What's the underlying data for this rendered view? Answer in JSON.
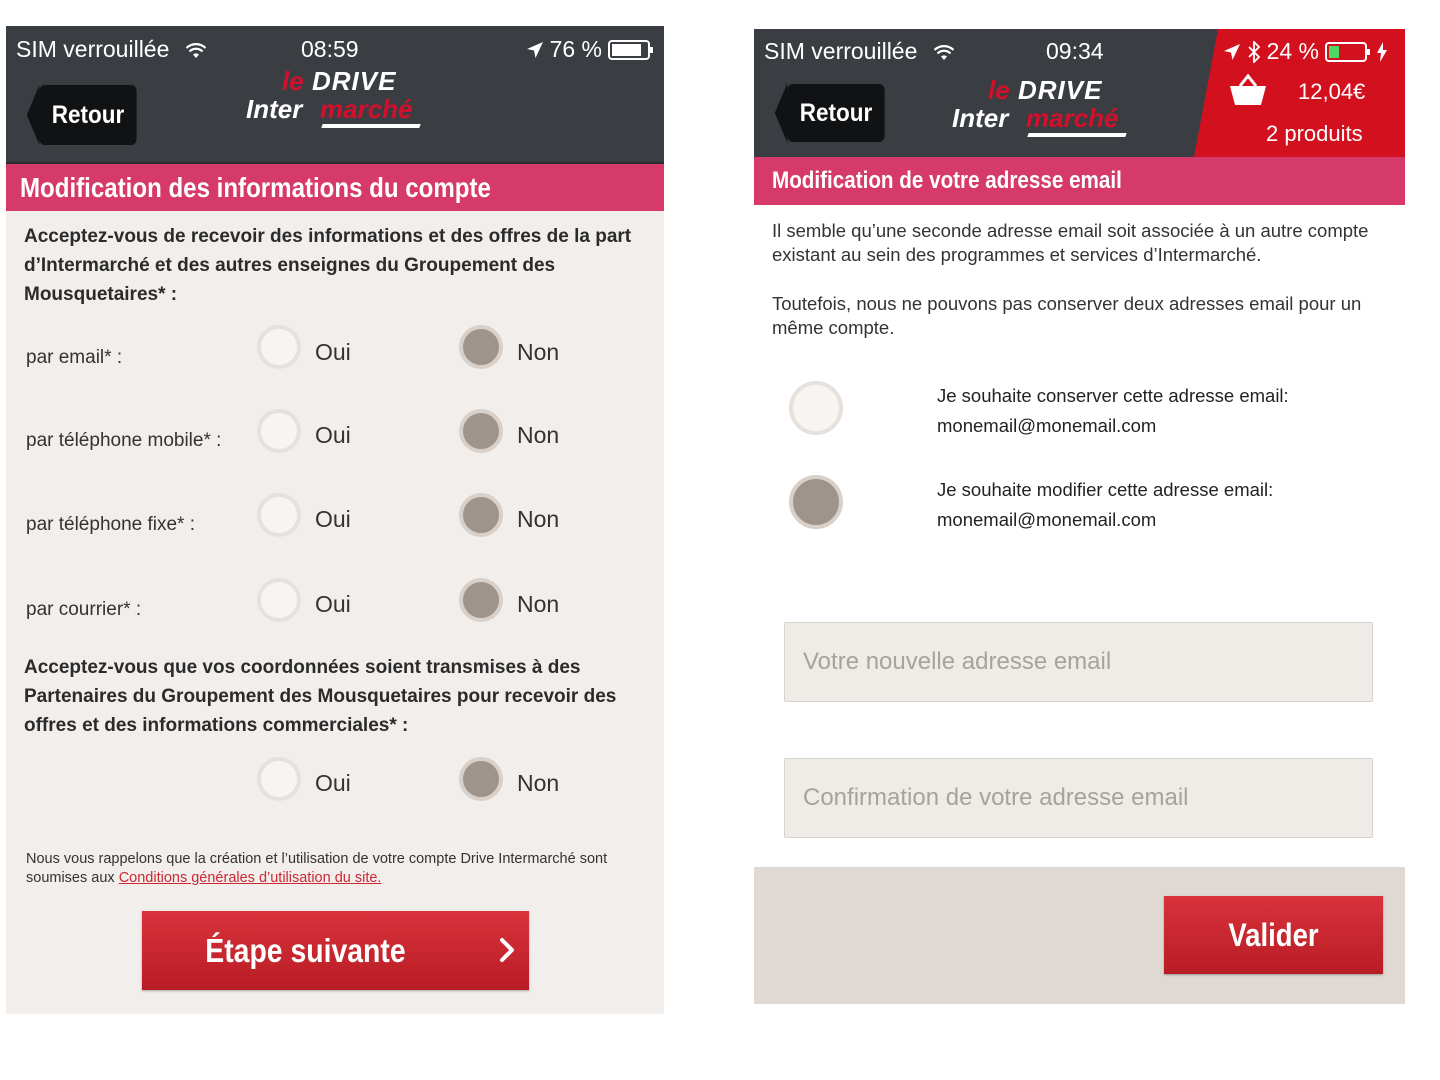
{
  "left_screen": {
    "status": {
      "carrier": "SIM verrouillée",
      "time": "08:59",
      "battery": "76 %"
    },
    "header": {
      "back_label": "Retour",
      "logo_le": "le",
      "logo_drive": "DRIVE",
      "logo_inter": "Inter",
      "logo_marche": "marché"
    },
    "title": "Modification des informations du compte",
    "question1": "Acceptez-vous de recevoir des informations et des offres de la part d’Intermarché et des autres enseignes du Groupement des Mousquetaires* :",
    "rows": [
      {
        "label": "par email* :",
        "yes": "Oui",
        "no": "Non",
        "selected": "no"
      },
      {
        "label": "par téléphone mobile* :",
        "yes": "Oui",
        "no": "Non",
        "selected": "no"
      },
      {
        "label": "par téléphone fixe* :",
        "yes": "Oui",
        "no": "Non",
        "selected": "no"
      },
      {
        "label": "par courrier* :",
        "yes": "Oui",
        "no": "Non",
        "selected": "no"
      }
    ],
    "question2": "Acceptez-vous que vos coordonnées soient transmises à des Partenaires du Groupement des Mousquetaires pour recevoir des offres et des informations commerciales* :",
    "q2_answer": {
      "yes": "Oui",
      "no": "Non",
      "selected": "no"
    },
    "fineprint_text": "Nous vous rappelons que la création et l’utilisation de votre compte Drive Intermarché sont soumises aux ",
    "fineprint_link": "Conditions générales d’utilisation du site.",
    "next_button": "Étape suivante",
    "next_arrow": "›"
  },
  "right_screen": {
    "status": {
      "carrier": "SIM verrouillée",
      "time": "09:34",
      "battery": "24 %"
    },
    "header": {
      "back_label": "Retour",
      "logo_le": "le",
      "logo_drive": "DRIVE",
      "logo_inter": "Inter",
      "logo_marche": "marché"
    },
    "cart": {
      "total": "12,04€",
      "count": "2 produits"
    },
    "title": "Modification de votre adresse email",
    "paragraph1": "Il semble qu’une seconde adresse email soit associée à un autre compte existant au sein des programmes et services d’Intermarché.",
    "paragraph2": "Toutefois, nous ne pouvons pas conserver deux adresses email pour un même compte.",
    "choices": [
      {
        "label": "Je souhaite conserver cette adresse email:",
        "email": "monemail@monemail.com",
        "selected": false
      },
      {
        "label": "Je souhaite modifier cette adresse email:",
        "email": "monemail@monemail.com",
        "selected": true
      }
    ],
    "new_email_placeholder": "Votre nouvelle adresse email",
    "confirm_email_placeholder": "Confirmation de votre adresse email",
    "submit_button": "Valider"
  },
  "colors": {
    "header": "#3a3d42",
    "banner": "#d63a6a",
    "accent_red": "#d3101e",
    "radio_selected": "#9e948c"
  }
}
